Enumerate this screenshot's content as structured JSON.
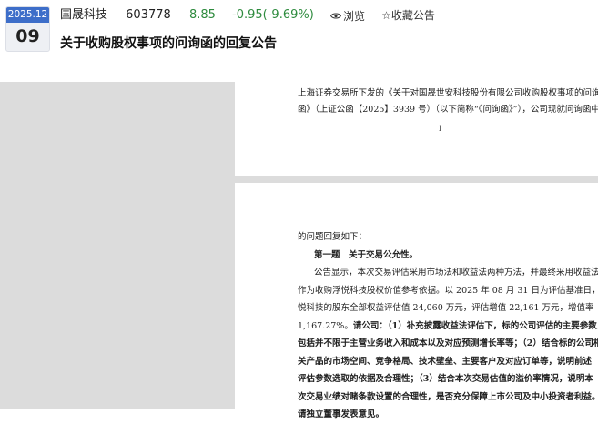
{
  "header": {
    "date_ym": "2025.12",
    "date_day": "09",
    "stock_name": "国晟科技",
    "stock_code": "603778",
    "price": "8.85",
    "change": "-0.95(-9.69%)",
    "browse_label": "浏览",
    "favorite_label": "☆收藏公告",
    "title": "关于收购股权事项的问询函的回复公告",
    "colors": {
      "badge": "#3d6ec9",
      "down": "#2e8b3e"
    }
  },
  "page1": {
    "lines": [
      "上海证券交易所下发的《关于对国晟世安科技股份有限公司收购股权事项的问询",
      "函》（上证公函【2025】3939 号）（以下简称“《问询函》”），公司现就问询函中"
    ],
    "page_number": "1"
  },
  "page2": {
    "line1": "的问题回复如下：",
    "line2": "第一题　关于交易公允性。",
    "line3": "公告显示，本次交易评估采用市场法和收益法两种方法，并最终采用收益法",
    "line4": "作为收购浮悦科技股权价值参考依据。以 2025 年 08 月 31 日为评估基准日，浮",
    "line5": "悦科技的股东全部权益评估值 24,060 万元，评估增值 22,161 万元，增值率",
    "line6_plain": "1,167.27%。",
    "line6_bold": "请公司：（1）补充披露收益法评估下，标的公司评估的主要参数，",
    "line7": "包括并不限于主营业务收入和成本以及对应预测增长率等；（2）结合标的公司相",
    "line8": "关产品的市场空间、竞争格局、技术壁垒、主要客户及对应订单等，说明前述",
    "line9": "评估参数选取的依据及合理性；（3）结合本次交易估值的溢价率情况，说明本",
    "line10": "次交易业绩对赌条款设置的合理性，是否充分保障上市公司及中小投资者利益。",
    "line11": "请独立董事发表意见。"
  }
}
